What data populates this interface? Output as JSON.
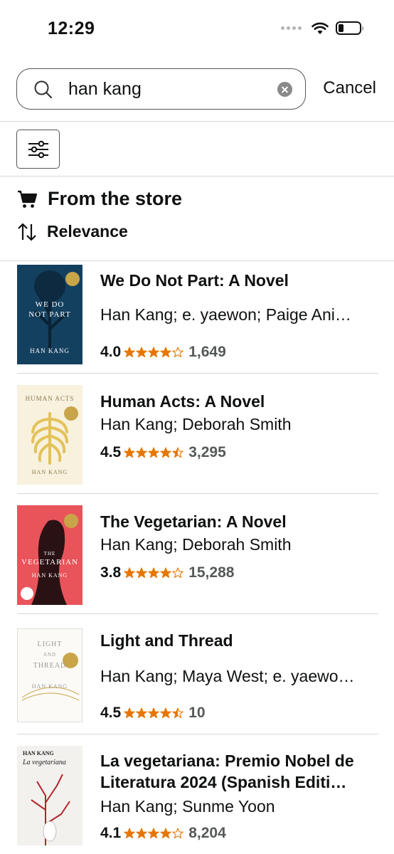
{
  "status_bar": {
    "time": "12:29"
  },
  "search": {
    "query": "han kang",
    "cancel_label": "Cancel"
  },
  "store": {
    "label": "From the store"
  },
  "sort": {
    "label": "Relevance"
  },
  "colors": {
    "star": "#e77600",
    "count": "#565959",
    "divider": "#d5d9d9"
  },
  "results": [
    {
      "title": "We Do Not Part: A Novel",
      "author": "Han Kang; e. yaewon; Paige Ani…",
      "rating": "4.0",
      "rating_value": 4.0,
      "count": "1,649",
      "cover": {
        "line1": "WE DO",
        "line2": "NOT PART",
        "author": "HAN KANG",
        "bg": "#17466d"
      }
    },
    {
      "title": "Human Acts: A Novel",
      "author": "Han Kang; Deborah Smith",
      "rating": "4.5",
      "rating_value": 4.5,
      "count": "3,295",
      "cover": {
        "line1": "HUMAN ACTS",
        "author": "HAN KANG",
        "bg": "#f7f0dc"
      }
    },
    {
      "title": "The Vegetarian: A Novel",
      "author": "Han Kang; Deborah Smith",
      "rating": "3.8",
      "rating_value": 3.8,
      "count": "15,288",
      "cover": {
        "line1": "THE",
        "line2": "VEGETARIAN",
        "author": "HAN KANG",
        "bg": "#e8545a"
      }
    },
    {
      "title": "Light and Thread",
      "author": "Han Kang; Maya West; e. yaewo…",
      "rating": "4.5",
      "rating_value": 4.5,
      "count": "10",
      "cover": {
        "line1": "LIGHT",
        "line2": "AND",
        "line3": "THREAD",
        "author": "HAN KANG",
        "bg": "#fbfaf6"
      }
    },
    {
      "title": "La vegetariana: Premio Nobel de Literatura 2024 (Spanish Editi…",
      "author": "Han Kang; Sunme Yoon",
      "rating": "4.1",
      "rating_value": 4.1,
      "count": "8,204",
      "cover": {
        "line1": "HAN KANG",
        "line2": "La vegetariana",
        "bg": "#f3f1ee"
      }
    }
  ]
}
